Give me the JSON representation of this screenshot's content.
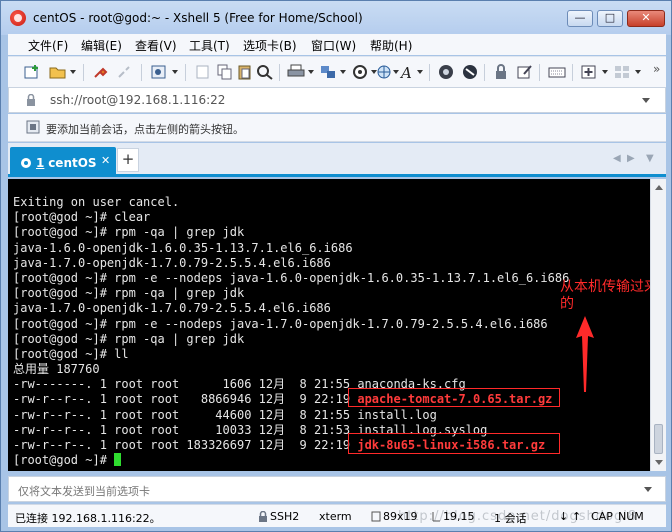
{
  "window": {
    "title": "centOS - root@god:~ - Xshell 5 (Free for Home/School)",
    "controls": {
      "minimize": "—",
      "maximize": "□",
      "close": "✕"
    }
  },
  "menu": {
    "items": [
      "文件(F)",
      "编辑(E)",
      "查看(V)",
      "工具(T)",
      "选项卡(B)",
      "窗口(W)",
      "帮助(H)"
    ]
  },
  "toolbar": {
    "icons": [
      "new-session-icon",
      "open-folder-icon",
      "connect-icon",
      "disconnect-icon",
      "properties-icon",
      "new-tab-icon",
      "copy-icon",
      "paste-icon",
      "find-icon",
      "print-icon",
      "transfer-icon",
      "color-scheme-icon",
      "globe-icon",
      "font-icon",
      "xftp-icon",
      "xmanager-icon",
      "lock-icon",
      "compose-icon",
      "keyboard-icon",
      "add-icon",
      "layout-icon"
    ]
  },
  "address": {
    "value": "ssh://root@192.168.1.116:22"
  },
  "hint": {
    "text": "要添加当前会话，点击左侧的箭头按钮。"
  },
  "tabs": {
    "active": {
      "number": "1",
      "name": "centOS"
    },
    "add_label": "+",
    "close_label": "✕"
  },
  "terminal": {
    "lines": [
      {
        "text": "Exiting on user cancel."
      },
      {
        "text": "[root@god ~]# clear"
      },
      {
        "text": "[root@god ~]# rpm -qa | grep jdk"
      },
      {
        "text": "java-1.6.0-openjdk-1.6.0.35-1.13.7.1.el6_6.i686"
      },
      {
        "text": "java-1.7.0-openjdk-1.7.0.79-2.5.5.4.el6.i686"
      },
      {
        "text": "[root@god ~]# rpm -e --nodeps java-1.6.0-openjdk-1.6.0.35-1.13.7.1.el6_6.i686"
      },
      {
        "text": "[root@god ~]# rpm -qa | grep jdk"
      },
      {
        "text": "java-1.7.0-openjdk-1.7.0.79-2.5.5.4.el6.i686"
      },
      {
        "text": "[root@god ~]# rpm -e --nodeps java-1.7.0-openjdk-1.7.0.79-2.5.5.4.el6.i686"
      },
      {
        "text": "[root@god ~]# rpm -qa | grep jdk"
      },
      {
        "text": "[root@god ~]# ll"
      },
      {
        "text": "总用量 187760"
      },
      {
        "text": "-rw-------. 1 root root      1606 12月  8 21:55 anaconda-ks.cfg"
      },
      {
        "text": "-rw-r--r--. 1 root root   8866946 12月  9 22:19 ",
        "highlight": "apache-tomcat-7.0.65.tar.gz"
      },
      {
        "text": "-rw-r--r--. 1 root root     44600 12月  8 21:55 install.log"
      },
      {
        "text": "-rw-r--r--. 1 root root     10033 12月  8 21:53 install.log.syslog"
      },
      {
        "text": "-rw-r--r--. 1 root root 183326697 12月  9 22:19 ",
        "highlight": "jdk-8u65-linux-i586.tar.gz"
      },
      {
        "text": "[root@god ~]# ",
        "cursor": true
      }
    ],
    "annotation": "从本机传输过来\n的"
  },
  "sendbar": {
    "text": "仅将文本发送到当前选项卡"
  },
  "status": {
    "connection": "已连接 192.168.1.116:22。",
    "protocol": "SSH2",
    "term": "xterm",
    "size": "89x19",
    "position": "19,15",
    "sessions": "1 会话",
    "caps": "CAP",
    "num": "NUM",
    "watermark": "http://blog.csdn.net/dogshdogi8"
  },
  "colors": {
    "accent": "#0f8ecf",
    "terminal_bg": "#000000",
    "terminal_fg": "#e6e6e6",
    "highlight": "#ff3b3b",
    "cursor": "#2fdc2f",
    "annotation": "#ff2a2a"
  }
}
